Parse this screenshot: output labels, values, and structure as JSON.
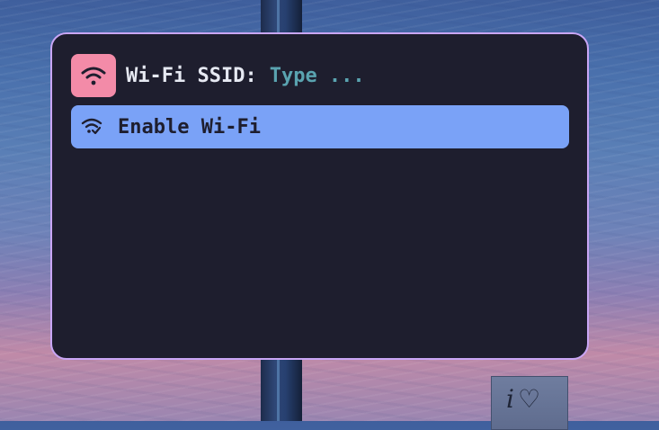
{
  "launcher": {
    "prompt_label": "Wi-Fi SSID:",
    "placeholder": "Type ...",
    "mode_icon": "wifi-icon",
    "items": [
      {
        "label": "Enable Wi-Fi",
        "icon": "wifi-check-icon",
        "selected": true
      }
    ]
  },
  "colors": {
    "window_background": "#1e1e2e",
    "window_border": "#c9a6f5",
    "icon_badge": "#f38ba8",
    "selected_item": "#7aa2f7",
    "placeholder_text": "#5aa3b0"
  },
  "wallpaper": {
    "sign_text": "i",
    "sign_symbol": "♡"
  }
}
